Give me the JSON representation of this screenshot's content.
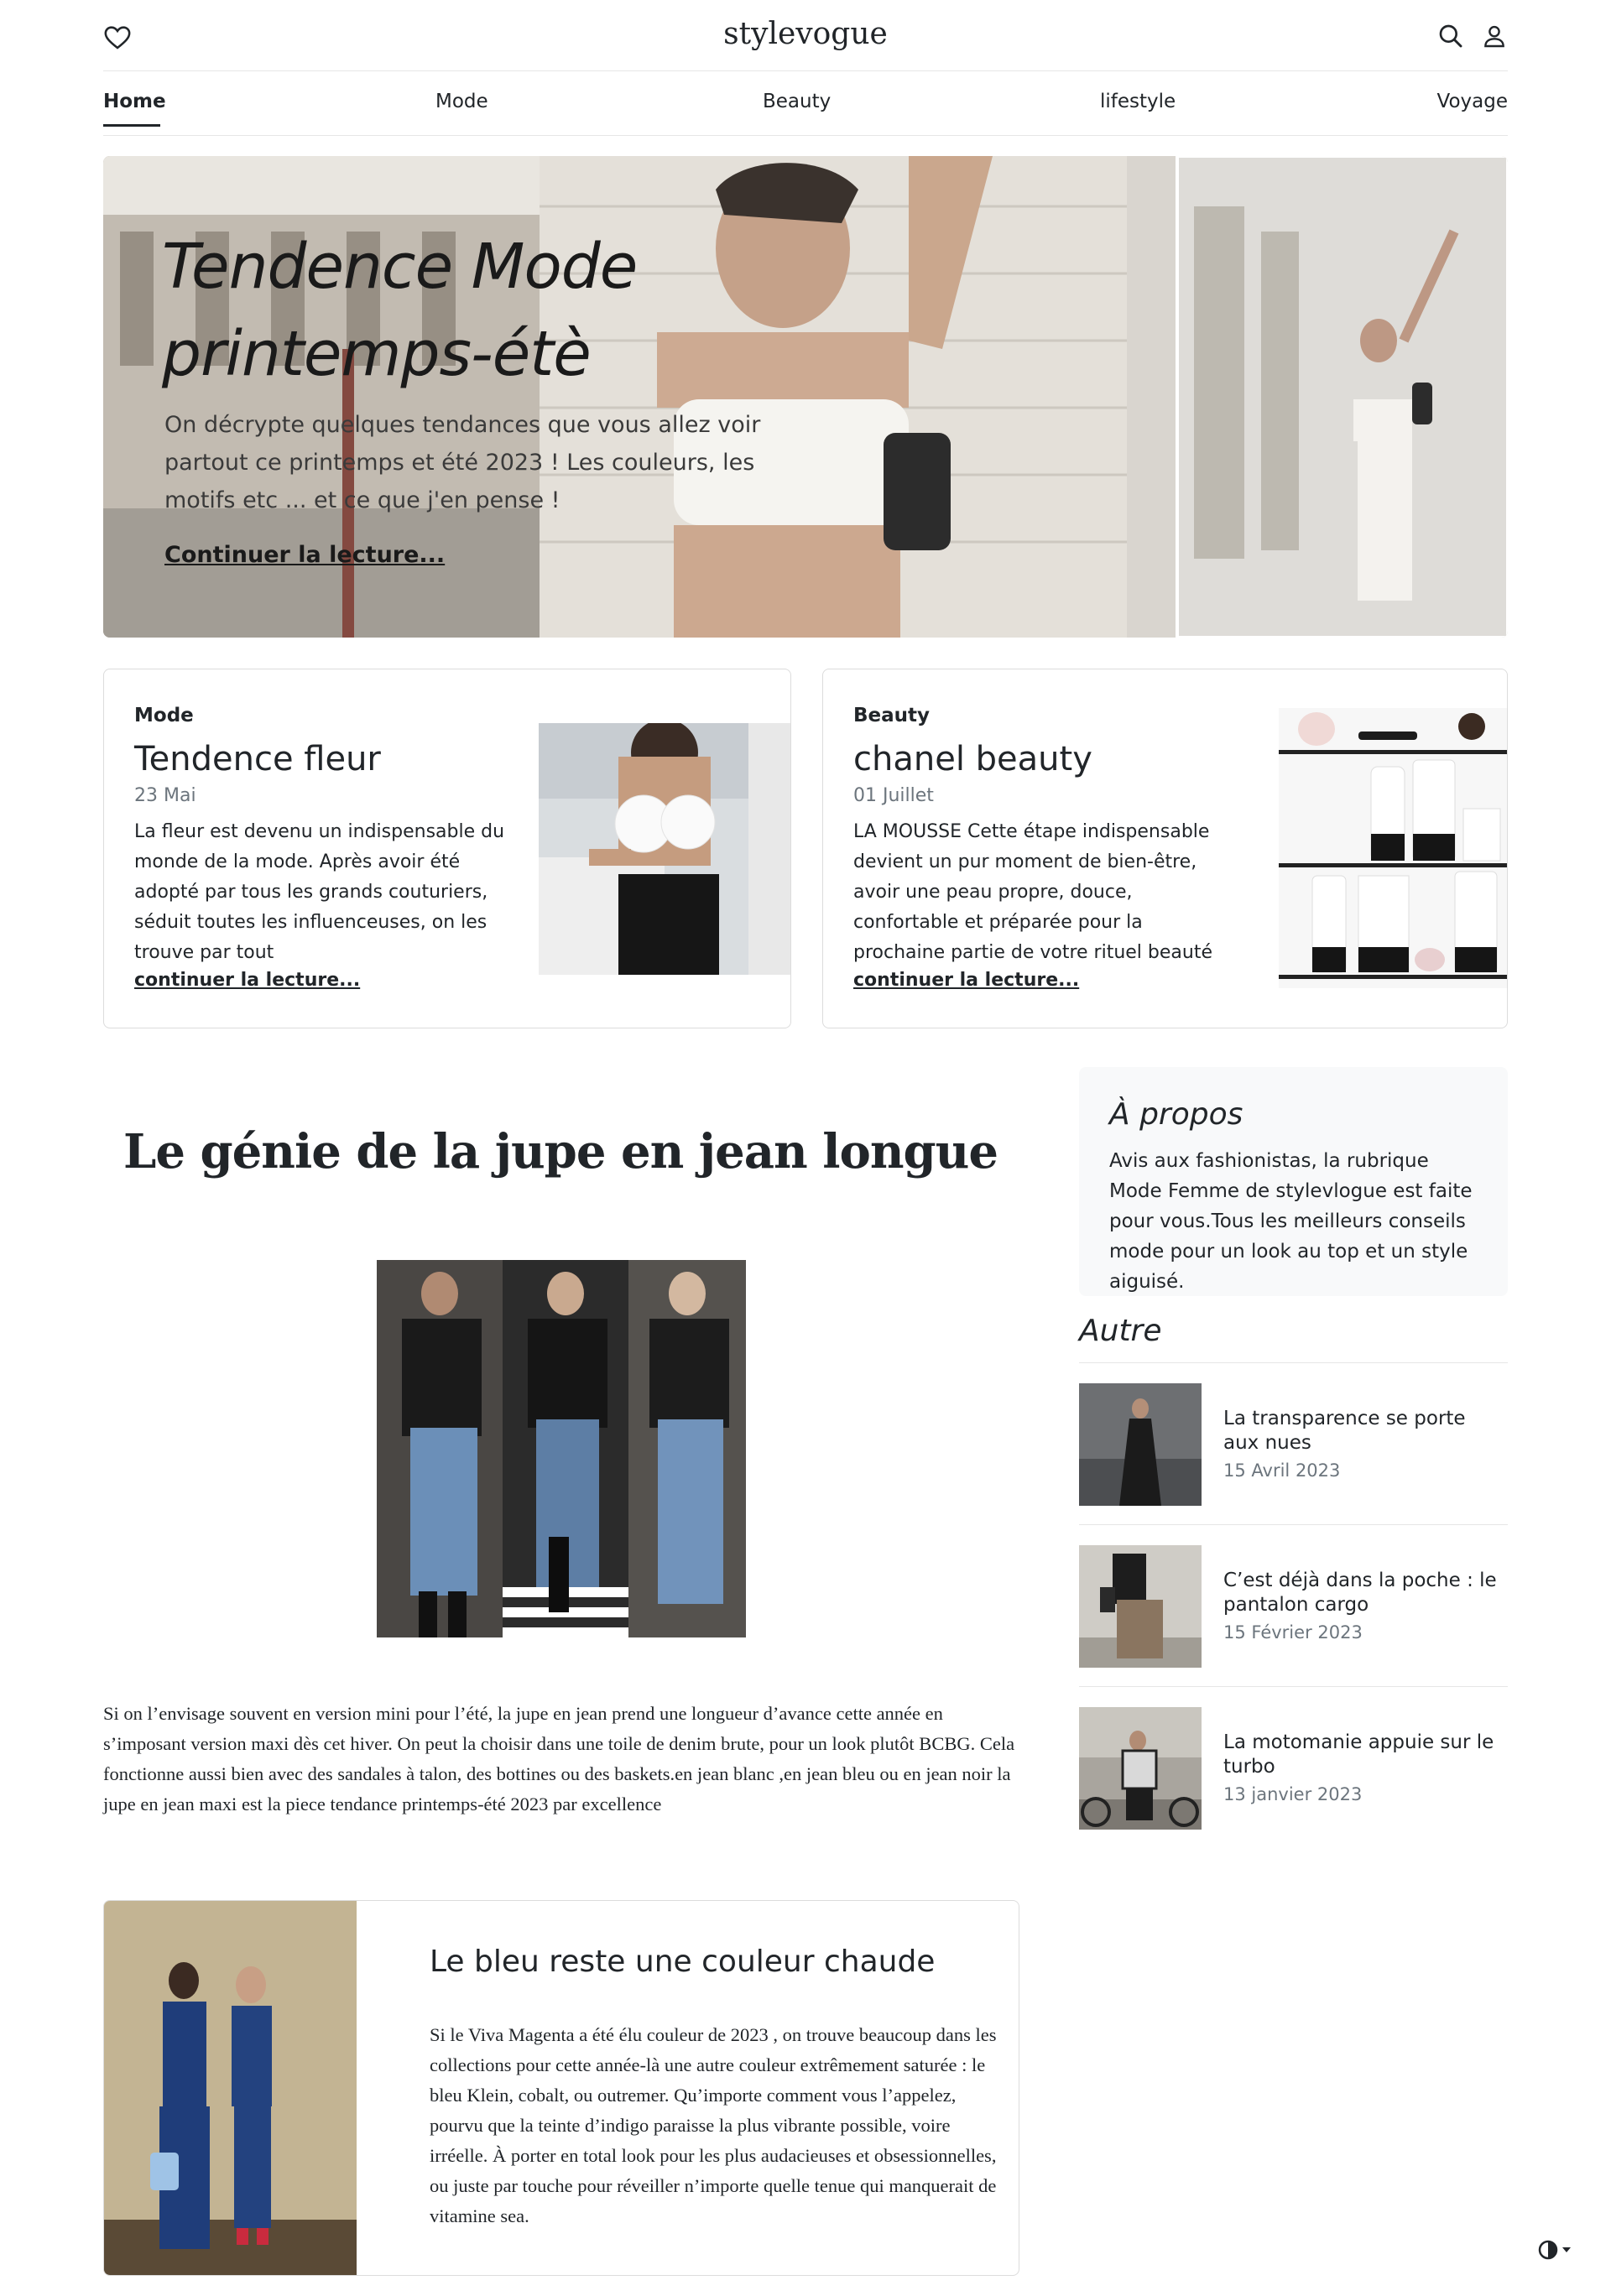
{
  "header": {
    "logo": "stylevogue",
    "icons": [
      "heart-icon",
      "search-icon",
      "user-icon"
    ]
  },
  "nav": {
    "items": [
      {
        "label": "Home",
        "active": true
      },
      {
        "label": "Mode"
      },
      {
        "label": "Beauty"
      },
      {
        "label": "lifestyle"
      },
      {
        "label": "Voyage"
      }
    ]
  },
  "hero": {
    "title": "Tendence Mode printemps-étè",
    "text": "On décrypte quelques tendances que vous allez voir partout ce printemps et été 2023 ! Les couleurs, les motifs etc ... et ce que j'en pense !",
    "link": "Continuer la lecture..."
  },
  "cards": [
    {
      "category": "Mode",
      "title": "Tendence fleur",
      "date": "23 Mai",
      "text": "La fleur est devenu un indispensable du monde de la mode. Après avoir été adopté par tous les grands couturiers, séduit toutes les influenceuses, on les trouve par tout",
      "link": "continuer la lecture..."
    },
    {
      "category": "Beauty",
      "title": "chanel beauty",
      "date": "01 Juillet",
      "text": "LA MOUSSE Cette étape indispensable devient un pur moment de bien-être, avoir une peau propre, douce, confortable et préparée pour la prochaine partie de votre rituel beauté",
      "link": "continuer la lecture..."
    }
  ],
  "article": {
    "title": "Le génie de la jupe en jean longue",
    "text": "Si on l’envisage souvent en version mini pour l’été, la jupe en jean prend une longueur d’avance cette année en s’imposant version maxi dès cet hiver. On peut la choisir dans une toile de denim brute, pour un look plutôt BCBG. Cela fonctionne aussi bien avec des sandales à talon, des bottines ou des baskets.en jean blanc ,en jean bleu ou en jean noir la jupe en jean maxi est la piece tendance printemps-été 2023 par excellence"
  },
  "feature": {
    "title": "Le bleu reste une couleur chaude",
    "text": "Si le Viva Magenta a été élu couleur de 2023 , on trouve beaucoup dans les collections pour cette année-là une autre couleur extrêmement saturée : le bleu Klein, cobalt, ou outremer. Qu’importe comment vous l’appelez, pourvu que la teinte d’indigo paraisse la plus vibrante possible, voire irréelle. À porter en total look pour les plus audacieuses et obsessionnelles, ou juste par touche pour réveiller n’importe quelle tenue qui manquerait de vitamine sea."
  },
  "sidebar": {
    "about_title": "À propos",
    "about_text": "Avis aux fashionistas, la rubrique Mode Femme de stylevlogue est faite pour vous.Tous les meilleurs conseils mode pour un look au top et un style aiguisé.",
    "other_title": "Autre",
    "items": [
      {
        "title": "La transparence se porte aux nues",
        "date": "15 Avril 2023"
      },
      {
        "title": "C’est déjà dans la poche : le pantalon cargo",
        "date": "15 Février 2023"
      },
      {
        "title": "La motomanie appuie sur le turbo",
        "date": "13 janvier 2023"
      }
    ]
  },
  "theme_toggle": "contrast-icon"
}
